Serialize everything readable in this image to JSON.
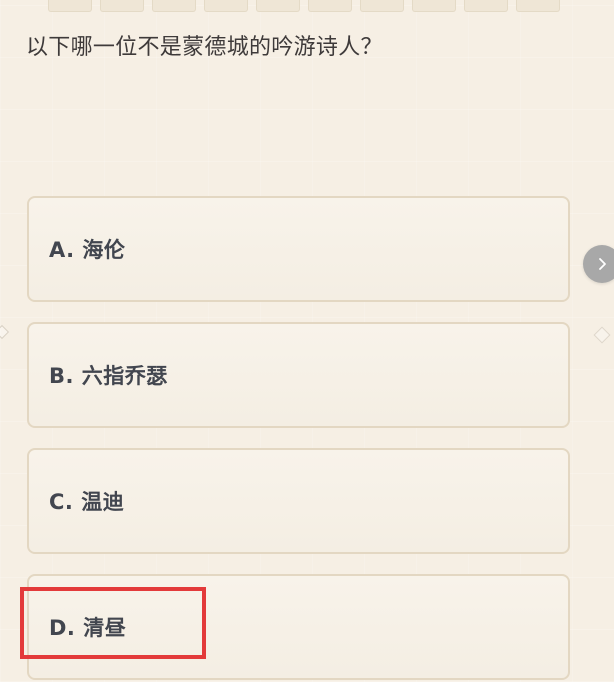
{
  "quiz": {
    "question": "以下哪一位不是蒙德城的吟游诗人？",
    "progress_count": 10,
    "options": [
      {
        "label": "A. 海伦"
      },
      {
        "label": "B. 六指乔瑟"
      },
      {
        "label": "C. 温迪"
      },
      {
        "label": "D. 清昼"
      }
    ],
    "highlighted_option": "D. 清昼",
    "next_icon": "chevron-right-icon"
  },
  "colors": {
    "background": "#f6efe4",
    "option_border": "#e3d7c2",
    "option_text": "#42464f",
    "highlight": "#e33a3a",
    "next_button": "#a8a8a8"
  }
}
